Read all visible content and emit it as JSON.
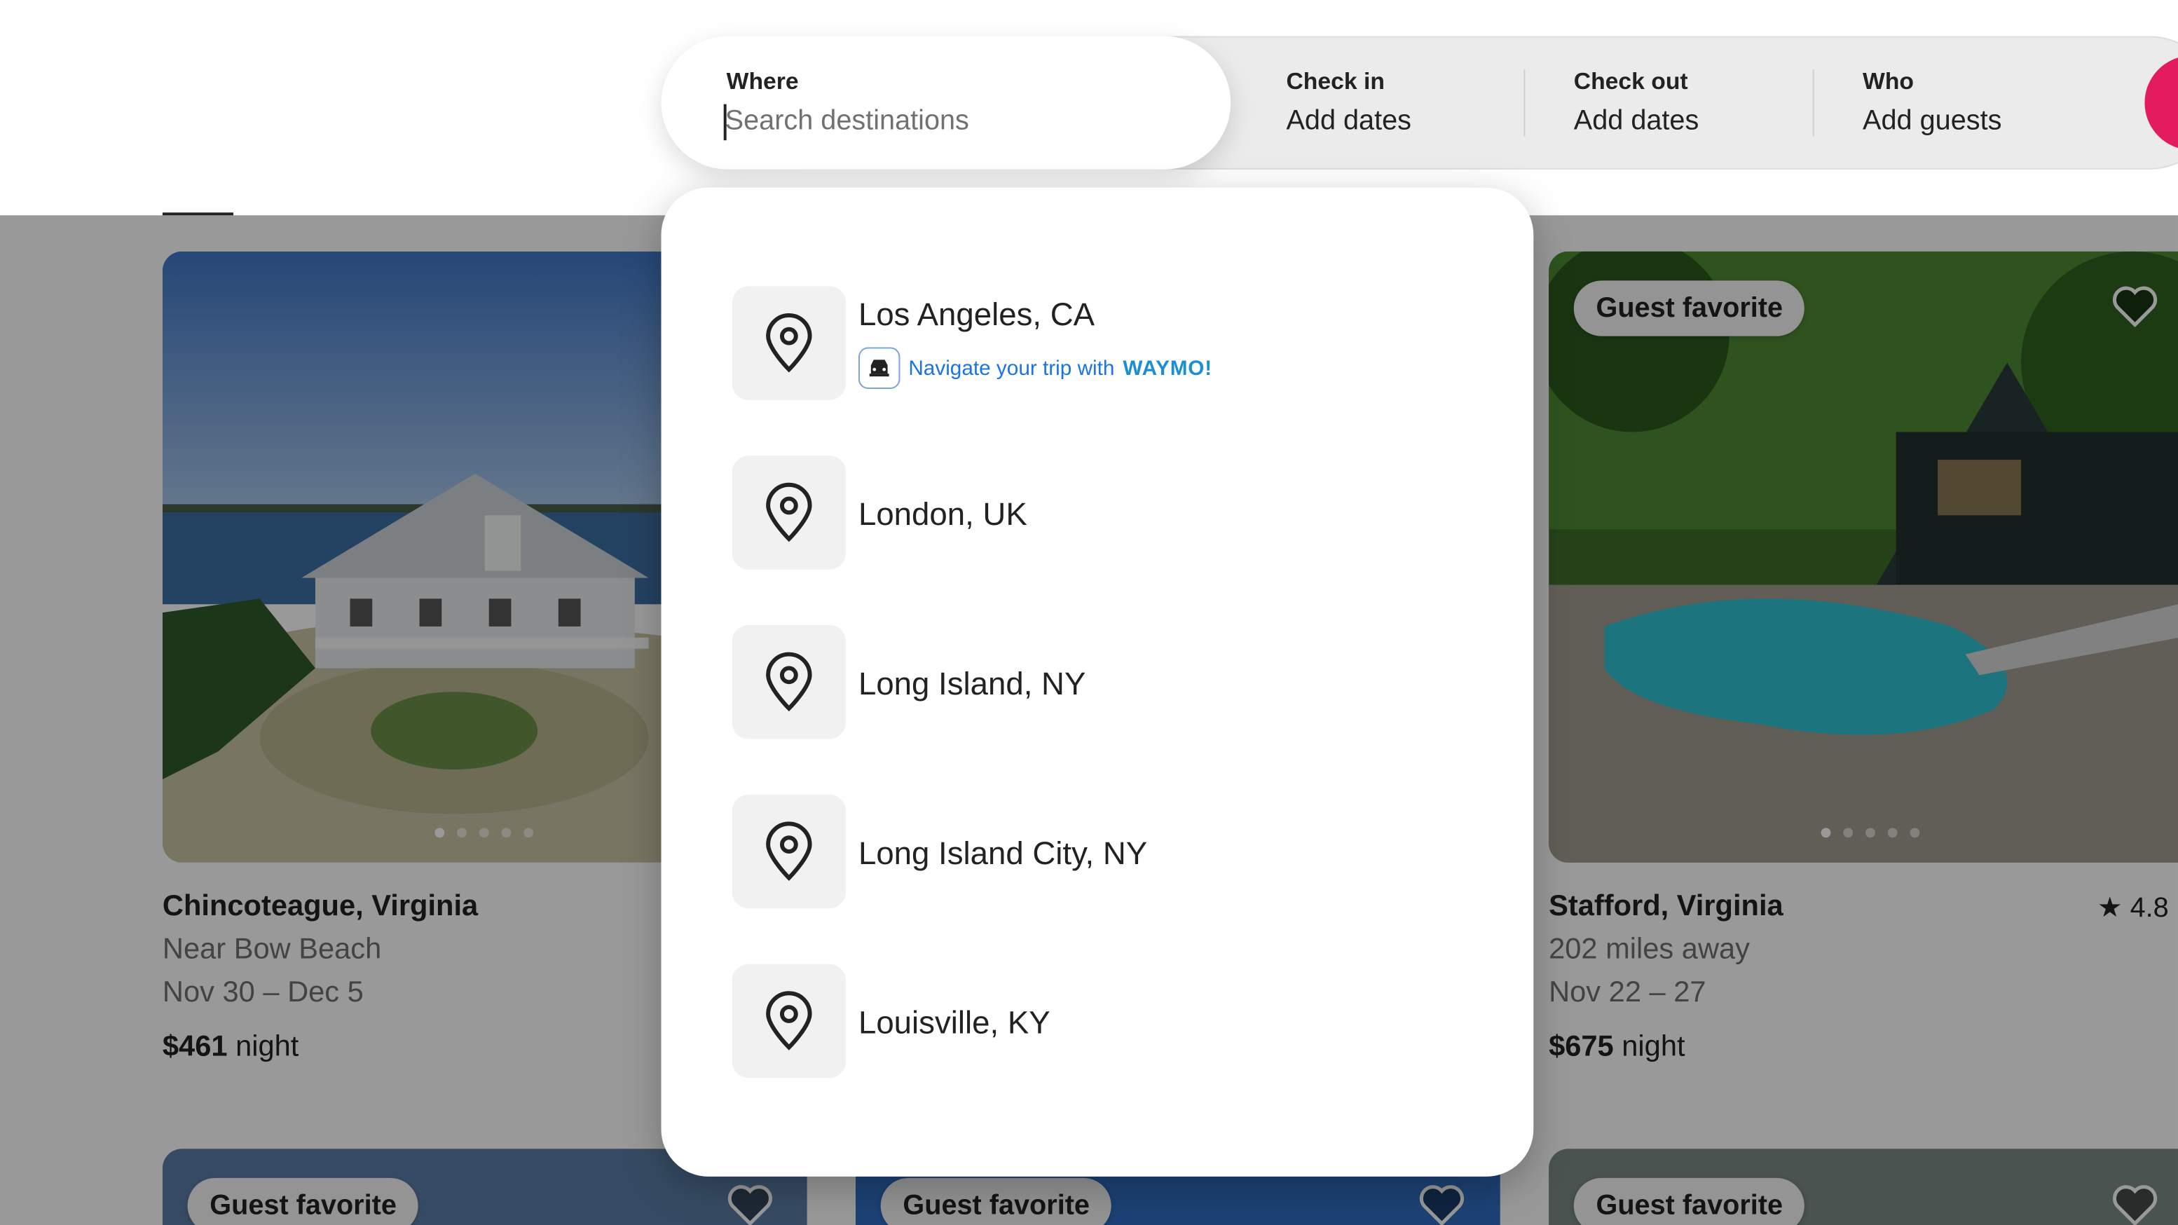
{
  "search": {
    "where_label": "Where",
    "where_placeholder": "Search destinations",
    "checkin_label": "Check in",
    "checkin_value": "Add dates",
    "checkout_label": "Check out",
    "checkout_value": "Add dates",
    "who_label": "Who",
    "who_value": "Add guests"
  },
  "suggestions": [
    {
      "label": "Los Angeles, CA",
      "promo_text": "Navigate your trip with",
      "promo_brand": "WAYMO!"
    },
    {
      "label": "London, UK"
    },
    {
      "label": "Long Island, NY"
    },
    {
      "label": "Long Island City, NY"
    },
    {
      "label": "Louisville, KY"
    }
  ],
  "listings": [
    {
      "title": "Chincoteague, Virginia",
      "subtitle": "Near Bow Beach",
      "dates": "Nov 30 – Dec 5",
      "price": "$461",
      "unit": "night"
    },
    {
      "title": "Stafford, Virginia",
      "subtitle": "202 miles away",
      "dates": "Nov 22 – 27",
      "price": "$675",
      "unit": "night",
      "rating": "4.8",
      "badge": "Guest favorite"
    }
  ],
  "bottom_row": [
    {
      "badge": "Guest favorite"
    },
    {
      "badge": "Guest favorite"
    },
    {
      "badge": "Guest favorite"
    }
  ],
  "colors": {
    "brand": "#e31c5f",
    "waymo": "#1a73e8"
  }
}
